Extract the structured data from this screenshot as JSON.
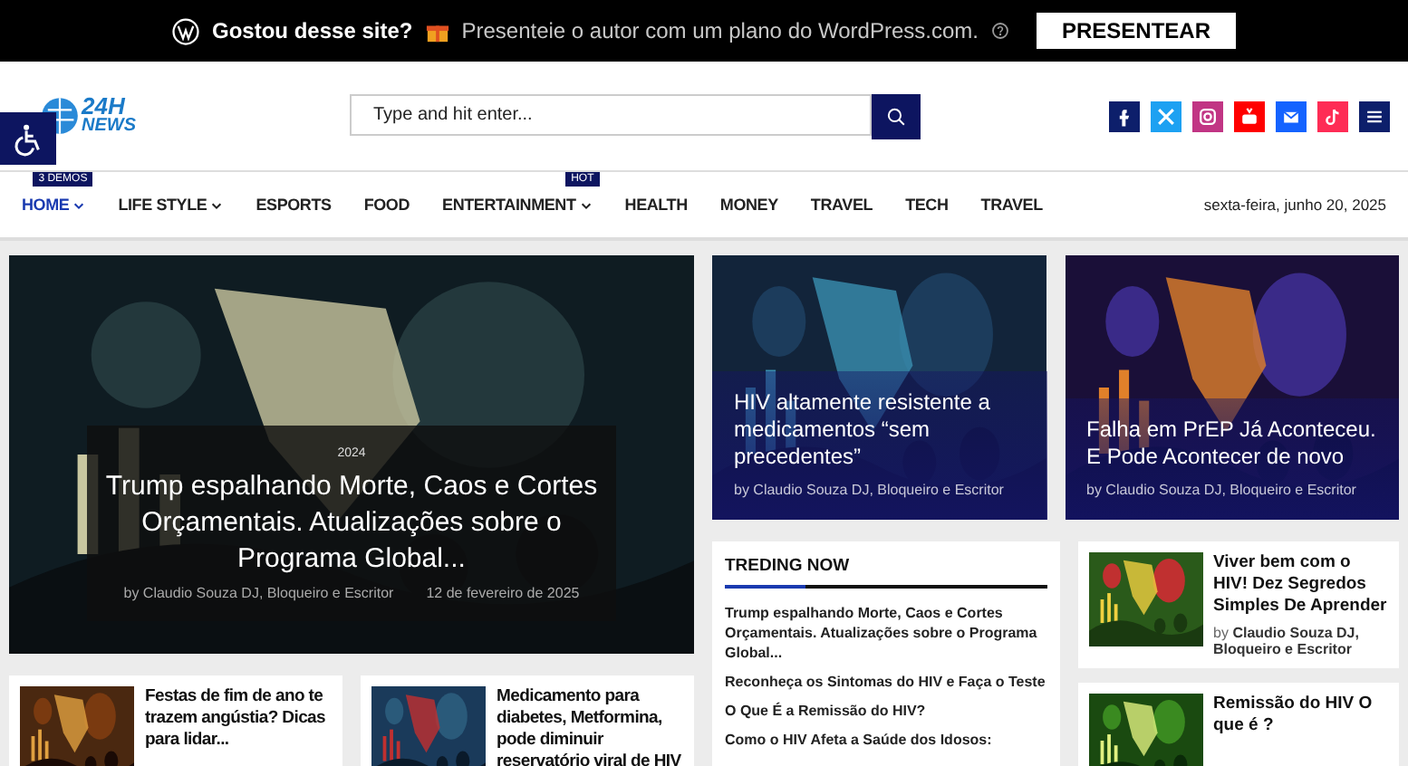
{
  "promo_bar": {
    "question": "Gostou desse site?",
    "message": "Presenteie o autor com um plano do WordPress.com.",
    "button": "PRESENTEAR"
  },
  "header": {
    "logo_top": "24H",
    "logo_bottom": "NEWS",
    "search": {
      "placeholder": "Type and hit enter..."
    },
    "social": [
      {
        "kind": "facebook",
        "color": "#0d1f6b"
      },
      {
        "kind": "x",
        "color": "#1da1f2"
      },
      {
        "kind": "instagram",
        "color": "#c13584"
      },
      {
        "kind": "youtube",
        "color": "#ff0000"
      },
      {
        "kind": "email",
        "color": "#1463ff"
      },
      {
        "kind": "tiktok",
        "color": "#fe2c55"
      },
      {
        "kind": "menu",
        "color": "#0d1f6b"
      }
    ]
  },
  "nav": {
    "items": [
      {
        "label": "HOME",
        "selected": true,
        "has_caret": true,
        "badge": "3 DEMOS"
      },
      {
        "label": "LIFE STYLE",
        "selected": false,
        "has_caret": true
      },
      {
        "label": "ESPORTS",
        "selected": false,
        "has_caret": false
      },
      {
        "label": "FOOD",
        "selected": false,
        "has_caret": false
      },
      {
        "label": "ENTERTAINMENT",
        "selected": false,
        "has_caret": true,
        "badge": "HOT"
      },
      {
        "label": "HEALTH",
        "selected": false,
        "has_caret": false
      },
      {
        "label": "MONEY",
        "selected": false,
        "has_caret": false
      },
      {
        "label": "TRAVEL",
        "selected": false,
        "has_caret": false
      },
      {
        "label": "TECH",
        "selected": false,
        "has_caret": false
      },
      {
        "label": "TRAVEL",
        "selected": false,
        "has_caret": false
      }
    ],
    "date": "sexta-feira, junho 20, 2025"
  },
  "hero": {
    "category": "2024",
    "title": "Trump espalhando Morte, Caos e Cortes Orçamentais. Atualizações sobre o Programa Global...",
    "author": "by Claudio Souza DJ, Bloqueiro e Escritor",
    "date": "12 de fevereiro de 2025"
  },
  "feature_cards": [
    {
      "title": "HIV altamente resistente a medicamentos “sem precedentes”",
      "author": "by Claudio Souza DJ, Bloqueiro e Escritor"
    },
    {
      "title": "Falha em PrEP Já Aconteceu. E Pode Acontecer de novo",
      "author": "by Claudio Souza DJ, Bloqueiro e Escritor"
    }
  ],
  "small_posts": [
    {
      "title": "Festas de fim de ano te trazem angústia? Dicas para lidar..."
    },
    {
      "title": "Medicamento para diabetes, Metformina, pode diminuir reservatório viral de HIV"
    }
  ],
  "trending": {
    "heading": "TREDING NOW",
    "items": [
      "Trump espalhando Morte, Caos e Cortes Orçamentais. Atualizações sobre o Programa Global...",
      "Reconheça os Sintomas do HIV e Faça o Teste",
      "O Que É a Remissão do HIV?",
      "Como o HIV Afeta a Saúde dos Idosos:"
    ]
  },
  "side_posts": [
    {
      "title": "Viver bem com o HIV! Dez Segredos Simples De Aprender",
      "by": "by",
      "author": "Claudio Souza DJ, Bloqueiro e Escritor"
    },
    {
      "title": "Remissão do HIV O que é ?"
    }
  ]
}
